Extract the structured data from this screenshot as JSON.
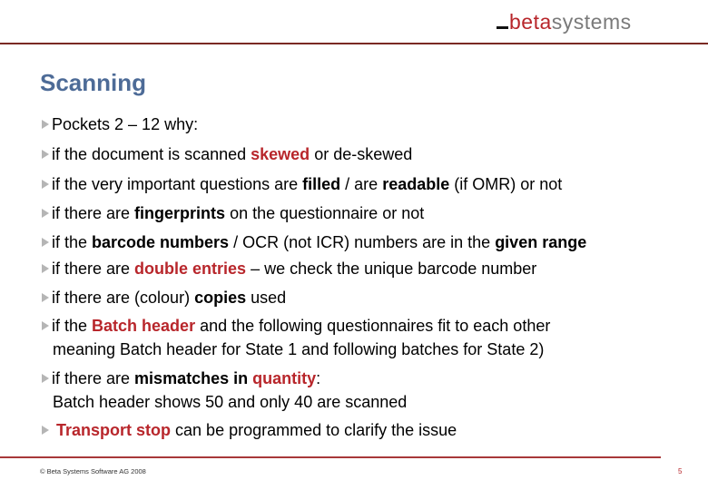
{
  "header": {
    "logo": {
      "prefix": "beta",
      "suffix": "systems"
    }
  },
  "slide": {
    "title": "Scanning",
    "bullets": [
      {
        "segments": [
          {
            "t": "Pockets 2 – 12   why:",
            "s": ""
          }
        ]
      },
      {
        "segments": [
          {
            "t": "if the document is scanned ",
            "s": ""
          },
          {
            "t": "skewed",
            "s": "r"
          },
          {
            "t": " or de-skewed",
            "s": ""
          }
        ]
      },
      {
        "segments": [
          {
            "t": "if the very important questions are ",
            "s": ""
          },
          {
            "t": "filled",
            "s": "b"
          },
          {
            "t": " / are ",
            "s": ""
          },
          {
            "t": "readable",
            "s": "b"
          },
          {
            "t": " (if OMR) or not",
            "s": ""
          }
        ]
      },
      {
        "segments": [
          {
            "t": "if there are ",
            "s": ""
          },
          {
            "t": "fingerprints",
            "s": "b"
          },
          {
            "t": " on the questionnaire or not",
            "s": ""
          }
        ]
      },
      {
        "segments": [
          {
            "t": "if the ",
            "s": ""
          },
          {
            "t": "barcode numbers",
            "s": "b"
          },
          {
            "t": " / OCR (not ICR) numbers are in the ",
            "s": ""
          },
          {
            "t": "given range",
            "s": "b"
          }
        ]
      },
      {
        "segments": [
          {
            "t": "if there are ",
            "s": ""
          },
          {
            "t": "double entries",
            "s": "r"
          },
          {
            "t": " – we check the unique barcode number",
            "s": ""
          }
        ]
      },
      {
        "segments": [
          {
            "t": "if there are (colour) ",
            "s": ""
          },
          {
            "t": "copies",
            "s": "b"
          },
          {
            "t": " used",
            "s": ""
          }
        ]
      },
      {
        "segments": [
          {
            "t": "if the ",
            "s": ""
          },
          {
            "t": "Batch header",
            "s": "r"
          },
          {
            "t": " and the following questionnaires fit to each other",
            "s": ""
          }
        ],
        "line2": "meaning Batch header for State 1 and following batches for State 2)"
      },
      {
        "segments": [
          {
            "t": "if there are ",
            "s": ""
          },
          {
            "t": "mismatches in ",
            "s": "b"
          },
          {
            "t": "quantity",
            "s": "r"
          },
          {
            "t": ":",
            "s": ""
          }
        ],
        "line2": "Batch header shows 50 and only 40 are scanned"
      },
      {
        "segments": [
          {
            "t": " ",
            "s": ""
          },
          {
            "t": "Transport stop",
            "s": "r"
          },
          {
            "t": " can be programmed to clarify the issue",
            "s": ""
          }
        ]
      }
    ]
  },
  "footer": {
    "copyright": "© Beta Systems Software AG 2008",
    "page_number": "5"
  },
  "colors": {
    "accent_red": "#b8262b",
    "title_blue": "#4d6b97",
    "rule": "#7a2a24"
  }
}
